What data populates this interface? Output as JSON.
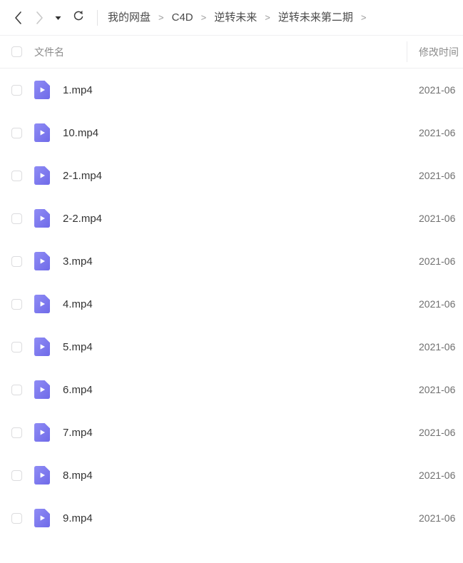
{
  "toolbar": {
    "back_icon": "chevron-left-icon",
    "forward_icon": "chevron-right-icon",
    "caret_icon": "caret-down-icon",
    "refresh_icon": "refresh-icon",
    "breadcrumb": {
      "separator": ">",
      "items": [
        {
          "label": "我的网盘"
        },
        {
          "label": "C4D"
        },
        {
          "label": "逆转未来"
        },
        {
          "label": "逆转未来第二期"
        }
      ],
      "trailing_separator": ">"
    }
  },
  "list": {
    "columns": {
      "name": "文件名",
      "modified": "修改时间"
    },
    "select_all_checked": false,
    "file_icon": "video-file-icon",
    "checkbox_icon": "checkbox-unchecked-icon",
    "rows": [
      {
        "name": "1.mp4",
        "modified": "2021-06",
        "checked": false
      },
      {
        "name": "10.mp4",
        "modified": "2021-06",
        "checked": false
      },
      {
        "name": "2-1.mp4",
        "modified": "2021-06",
        "checked": false
      },
      {
        "name": "2-2.mp4",
        "modified": "2021-06",
        "checked": false
      },
      {
        "name": "3.mp4",
        "modified": "2021-06",
        "checked": false
      },
      {
        "name": "4.mp4",
        "modified": "2021-06",
        "checked": false
      },
      {
        "name": "5.mp4",
        "modified": "2021-06",
        "checked": false
      },
      {
        "name": "6.mp4",
        "modified": "2021-06",
        "checked": false
      },
      {
        "name": "7.mp4",
        "modified": "2021-06",
        "checked": false
      },
      {
        "name": "8.mp4",
        "modified": "2021-06",
        "checked": false
      },
      {
        "name": "9.mp4",
        "modified": "2021-06",
        "checked": false
      }
    ]
  },
  "colors": {
    "file_icon_light": "#8f8cf5",
    "file_icon_dark": "#6f6ae8",
    "text_primary": "#333333",
    "text_secondary": "#8c8c8c",
    "border": "#efeff0"
  }
}
